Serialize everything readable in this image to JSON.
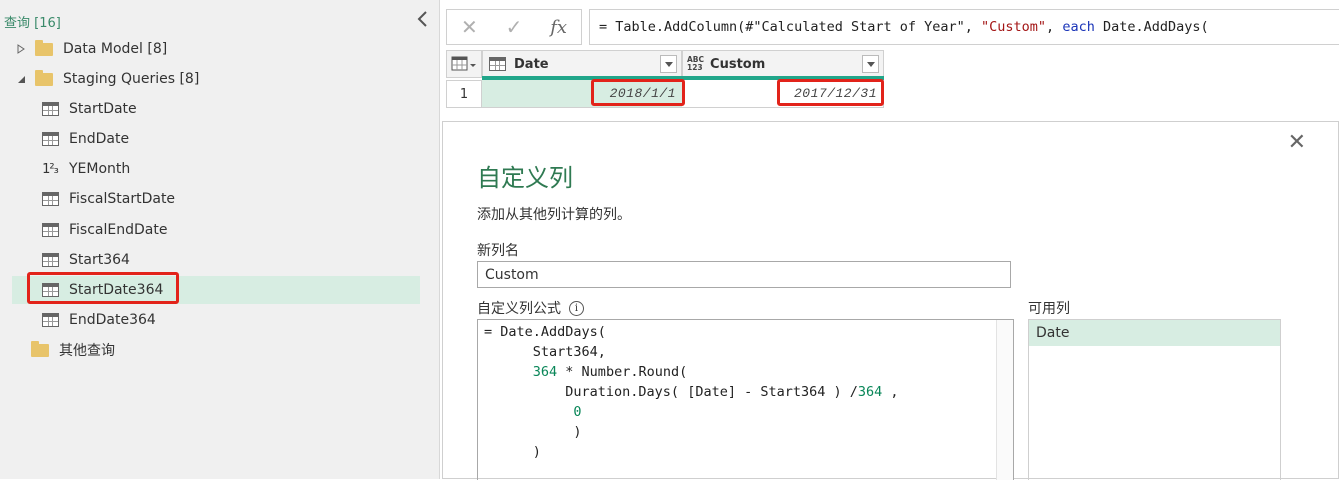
{
  "queries": {
    "header": "查询 [16]",
    "items": [
      {
        "label": "Data Model [8]",
        "icon": "folder-icon"
      },
      {
        "label": "Staging Queries [8]",
        "icon": "folder-icon"
      },
      {
        "label": "StartDate",
        "icon": "table-icon"
      },
      {
        "label": "EndDate",
        "icon": "table-icon"
      },
      {
        "label": "YEMonth",
        "icon": "number-icon",
        "icon_glyph": "1²₃"
      },
      {
        "label": "FiscalStartDate",
        "icon": "table-icon"
      },
      {
        "label": "FiscalEndDate",
        "icon": "table-icon"
      },
      {
        "label": "Start364",
        "icon": "table-icon"
      },
      {
        "label": "StartDate364",
        "icon": "table-icon",
        "selected": true
      },
      {
        "label": "EndDate364",
        "icon": "table-icon"
      },
      {
        "label": "其他查询",
        "icon": "folder-icon"
      }
    ]
  },
  "formula_bar": {
    "cancel_glyph": "✕",
    "confirm_glyph": "✓",
    "fx_glyph": "fx",
    "part1": "= Table.AddColumn(#\"Calculated Start of Year\", ",
    "string": "\"Custom\"",
    "part2": ", ",
    "keyword": "each",
    "part3": " Date.AddDays("
  },
  "grid": {
    "columns": [
      {
        "label": "Date",
        "type_icon": "calendar-table-icon"
      },
      {
        "label": "Custom",
        "type_icon": "abc-123-icon",
        "type_glyph_top": "ABC",
        "type_glyph_bottom": "123"
      }
    ],
    "rows": [
      {
        "row_number": "1",
        "date": "2018/1/1",
        "custom": "2017/12/31"
      }
    ]
  },
  "dialog": {
    "title": "自定义列",
    "subtitle": "添加从其他列计算的列。",
    "new_column_label": "新列名",
    "new_column_value": "Custom",
    "formula_label": "自定义列公式",
    "info_glyph": "i",
    "formula_lines": [
      [
        {
          "t": "= Date.AddDays("
        }
      ],
      [
        {
          "t": "      Start364,"
        }
      ],
      [
        {
          "t": "      "
        },
        {
          "t": "364",
          "c": "num"
        },
        {
          "t": " * Number.Round("
        }
      ],
      [
        {
          "t": "          Duration.Days( [Date] - Start364 ) /"
        },
        {
          "t": "364",
          "c": "num"
        },
        {
          "t": " ,"
        }
      ],
      [
        {
          "t": "           "
        },
        {
          "t": "0",
          "c": "num"
        }
      ],
      [
        {
          "t": "           )"
        }
      ],
      [
        {
          "t": "      )"
        }
      ]
    ],
    "available_label": "可用列",
    "available_columns": [
      "Date"
    ],
    "close_glyph": "✕"
  },
  "colors": {
    "accent_green": "#2f7a52",
    "selection_bg": "#d7ede2",
    "column_bar": "#21a68a",
    "highlight_red": "#e2231a",
    "string_color": "#a31515",
    "keyword_color": "#1a34b8",
    "number_color": "#098658"
  }
}
